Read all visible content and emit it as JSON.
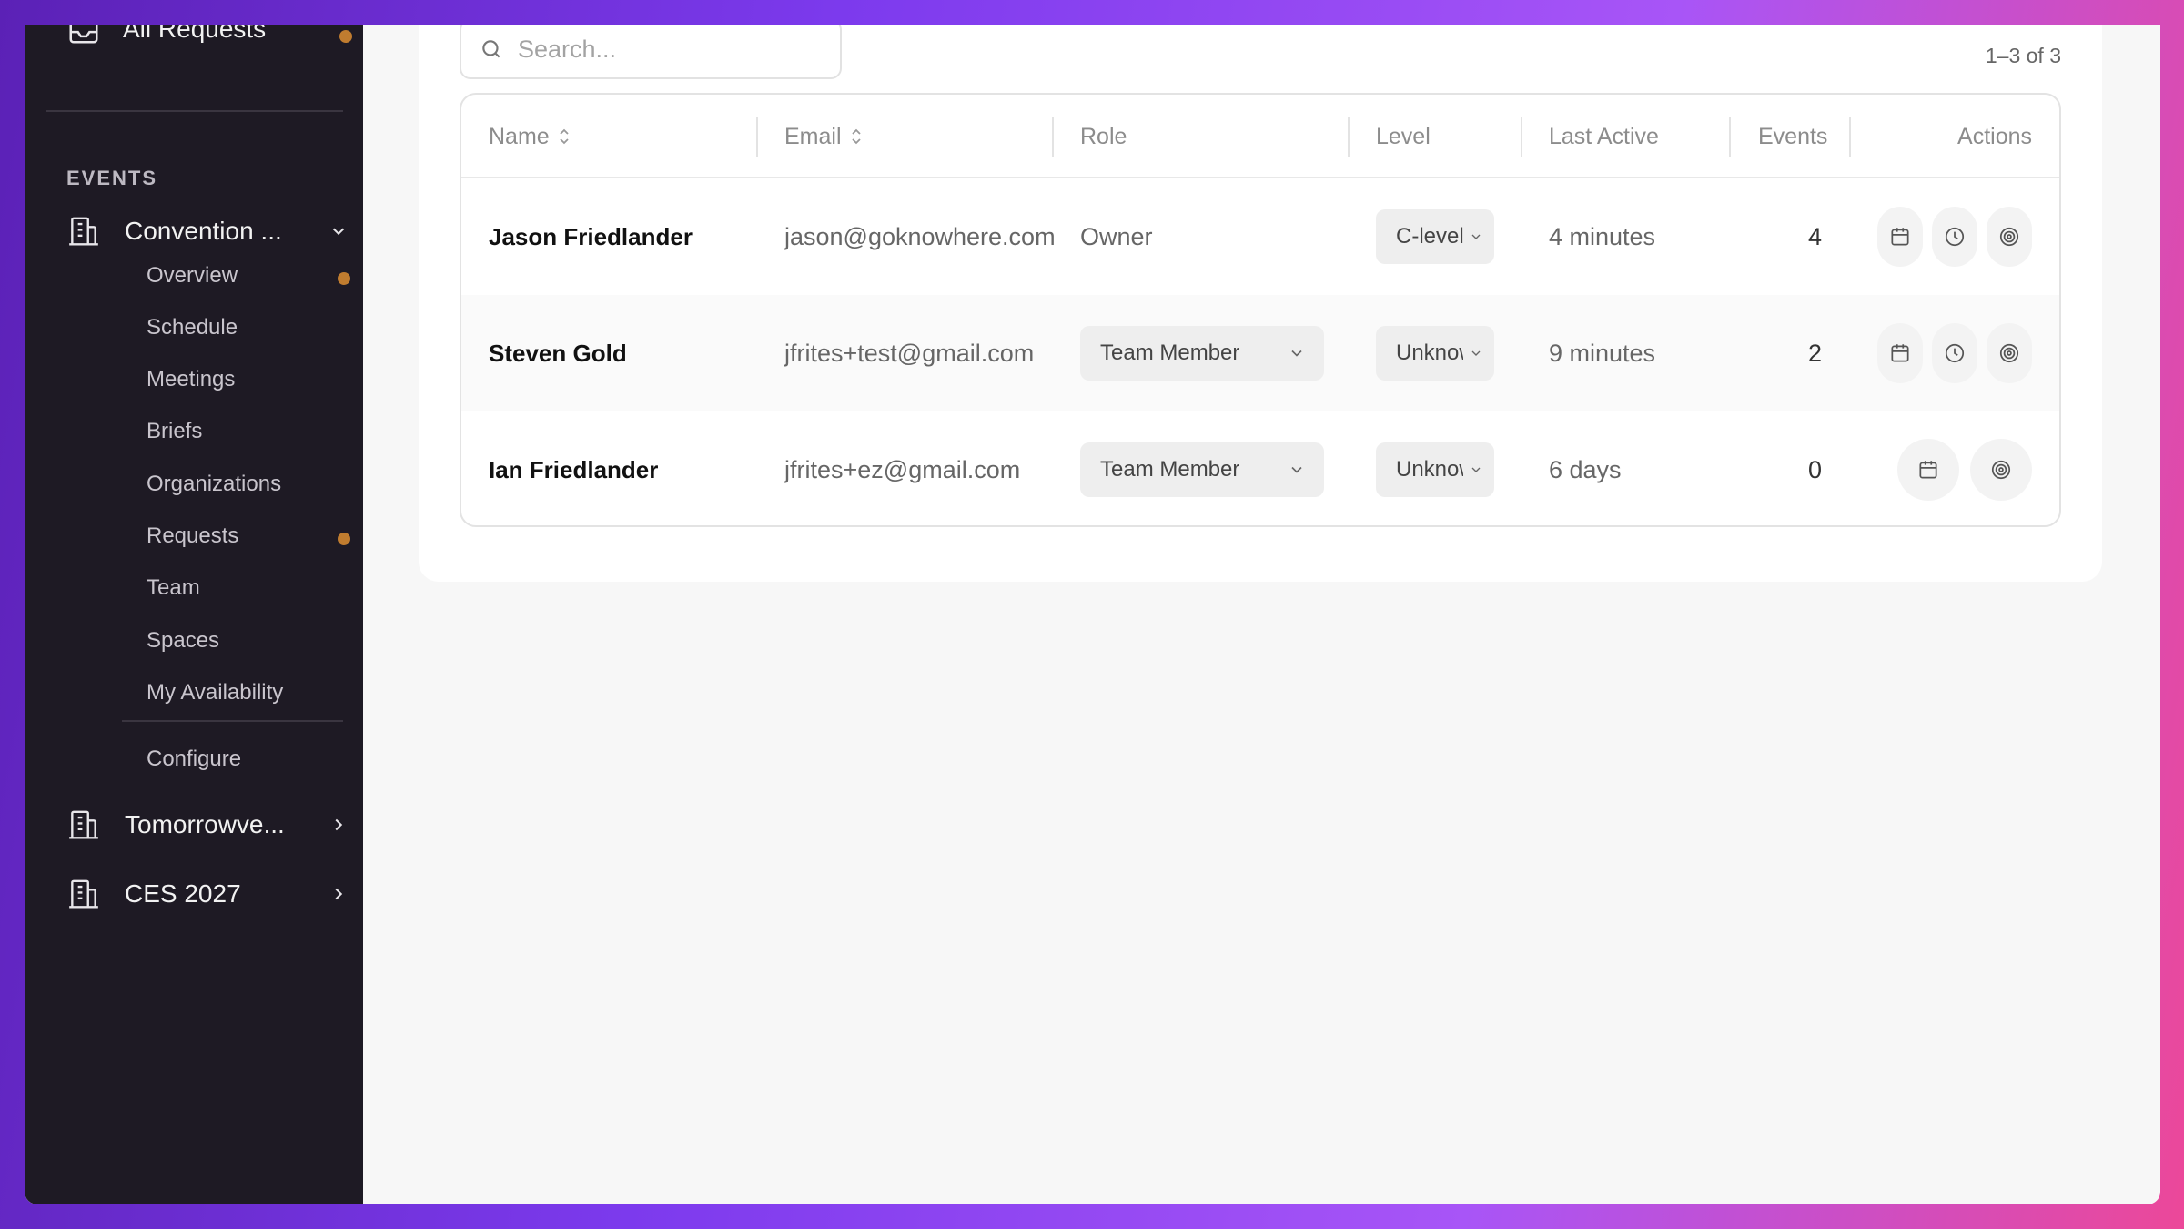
{
  "sidebar": {
    "top_item": {
      "label": "All Requests",
      "has_dot": true
    },
    "section_label": "EVENTS",
    "events": [
      {
        "label": "Convention ...",
        "expanded": true
      },
      {
        "label": "Tomorrowve...",
        "expanded": false
      },
      {
        "label": "CES 2027",
        "expanded": false
      }
    ],
    "sub_items": [
      {
        "label": "Overview",
        "has_dot": true
      },
      {
        "label": "Schedule",
        "has_dot": false
      },
      {
        "label": "Meetings",
        "has_dot": false
      },
      {
        "label": "Briefs",
        "has_dot": false
      },
      {
        "label": "Organizations",
        "has_dot": false
      },
      {
        "label": "Requests",
        "has_dot": true
      },
      {
        "label": "Team",
        "has_dot": false
      },
      {
        "label": "Spaces",
        "has_dot": false
      },
      {
        "label": "My Availability",
        "has_dot": false
      }
    ],
    "configure_label": "Configure"
  },
  "main": {
    "search": {
      "placeholder": "Search..."
    },
    "pager": "1–3 of 3",
    "table": {
      "columns": [
        "Name",
        "Email",
        "Role",
        "Level",
        "Last Active",
        "Events",
        "Actions"
      ],
      "rows": [
        {
          "name": "Jason Friedlander",
          "email": "jason@goknowhere.com",
          "role": "Owner",
          "role_editable": false,
          "level": "C-level",
          "last_active": "4 minutes",
          "events": "4",
          "actions": [
            "calendar-icon",
            "clock-icon",
            "target-icon"
          ]
        },
        {
          "name": "Steven Gold",
          "email": "jfrites+test@gmail.com",
          "role": "Team Member",
          "role_editable": true,
          "level": "Unknown",
          "last_active": "9 minutes",
          "events": "2",
          "actions": [
            "calendar-icon",
            "clock-icon",
            "target-icon"
          ]
        },
        {
          "name": "Ian Friedlander",
          "email": "jfrites+ez@gmail.com",
          "role": "Team Member",
          "role_editable": true,
          "level": "Unknown",
          "last_active": "6 days",
          "events": "0",
          "actions": [
            "calendar-icon",
            "target-icon"
          ]
        }
      ]
    }
  },
  "colors": {
    "sidebar_bg": "#1e1a24",
    "notification_dot": "#c07c2f",
    "page_bg": "#f7f7f7"
  }
}
